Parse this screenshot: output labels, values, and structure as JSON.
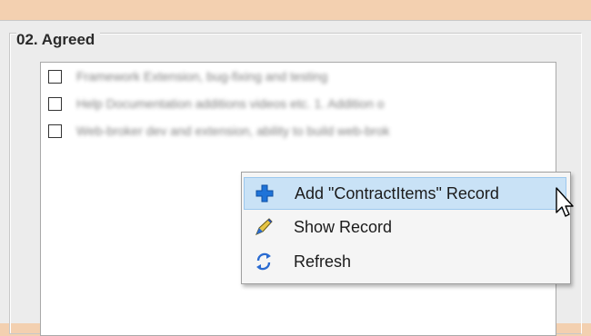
{
  "group": {
    "title": "02. Agreed"
  },
  "list": {
    "items": [
      {
        "text": "Framework Extension, bug-fixing and testing",
        "checked": false
      },
      {
        "text": "Help Documentation additions videos etc. 1. Addition o",
        "checked": false
      },
      {
        "text": "Web-broker dev and extension, ability to build web-brok",
        "checked": false
      }
    ]
  },
  "context_menu": {
    "items": [
      {
        "label": "Add \"ContractItems\" Record",
        "icon": "plus-icon",
        "highlighted": true
      },
      {
        "label": "Show Record",
        "icon": "pen-icon",
        "highlighted": false
      },
      {
        "label": "Refresh",
        "icon": "refresh-icon",
        "highlighted": false
      }
    ]
  },
  "colors": {
    "background": "#f3d0b0",
    "highlight": "#c9e2f6",
    "plus_icon": "#1e73d8"
  }
}
